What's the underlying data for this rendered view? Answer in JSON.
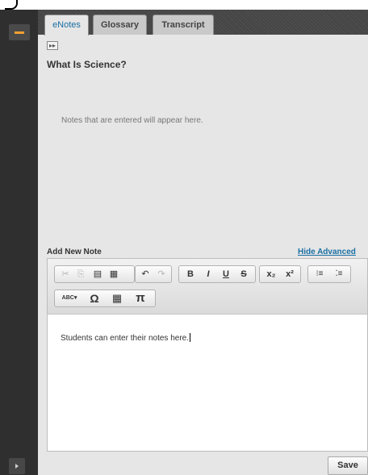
{
  "tabs": [
    {
      "label": "eNotes",
      "active": true
    },
    {
      "label": "Glossary",
      "active": false
    },
    {
      "label": "Transcript",
      "active": false
    }
  ],
  "section": {
    "title": "What Is Science?"
  },
  "notes": {
    "placeholder": "Notes that are entered will appear here."
  },
  "add_note": {
    "label": "Add New Note",
    "hide_advanced": "Hide Advanced"
  },
  "toolbar": {
    "row1": [
      {
        "name": "cut-icon",
        "glyph": "✂",
        "enabled": false
      },
      {
        "name": "copy-icon",
        "glyph": "⎘",
        "enabled": false
      },
      {
        "name": "paste-icon",
        "glyph": "▤",
        "enabled": true
      },
      {
        "name": "paste-word-icon",
        "glyph": "▦",
        "enabled": true
      },
      {
        "name": "undo-icon",
        "glyph": "↶",
        "enabled": true
      },
      {
        "name": "redo-icon",
        "glyph": "↷",
        "enabled": false
      },
      {
        "name": "bold-icon",
        "glyph": "B",
        "enabled": true
      },
      {
        "name": "italic-icon",
        "glyph": "I",
        "enabled": true
      },
      {
        "name": "underline-icon",
        "glyph": "U",
        "enabled": true
      },
      {
        "name": "strikethrough-icon",
        "glyph": "S",
        "enabled": true
      },
      {
        "name": "subscript-icon",
        "glyph": "x₂",
        "enabled": true
      },
      {
        "name": "superscript-icon",
        "glyph": "x²",
        "enabled": true
      },
      {
        "name": "numbered-list-icon",
        "glyph": "⁝≡",
        "enabled": true
      },
      {
        "name": "bulleted-list-icon",
        "glyph": "⁚≡",
        "enabled": true
      }
    ],
    "row2": [
      {
        "name": "spellcheck-icon",
        "glyph": "ABC▾",
        "enabled": true
      },
      {
        "name": "special-char-icon",
        "glyph": "Ω",
        "enabled": true
      },
      {
        "name": "table-icon",
        "glyph": "▦",
        "enabled": true
      },
      {
        "name": "pi-icon",
        "glyph": "π",
        "enabled": true
      }
    ]
  },
  "editor": {
    "content": "Students can enter their notes here."
  },
  "save_label": "Save",
  "colors": {
    "accent": "#1a6fa3",
    "collapse": "#f0a030",
    "rail": "#2f2f2f"
  }
}
